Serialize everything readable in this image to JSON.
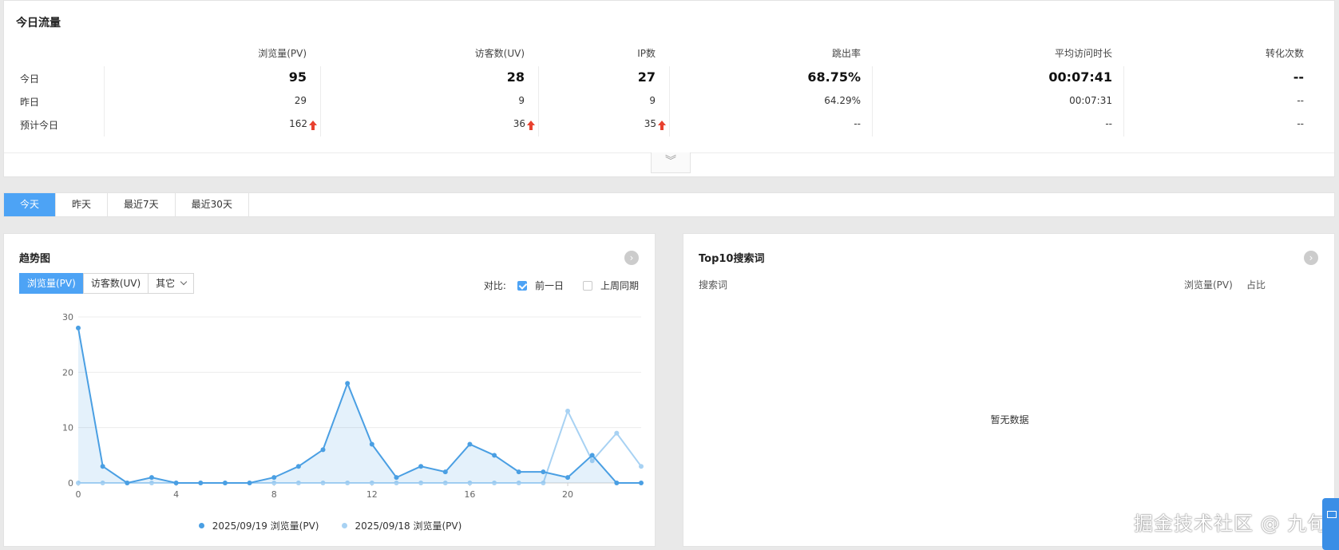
{
  "today_traffic": {
    "title": "今日流量",
    "columns": [
      "浏览量(PV)",
      "访客数(UV)",
      "IP数",
      "跳出率",
      "平均访问时长",
      "转化次数"
    ],
    "rows": [
      {
        "label": "今日",
        "values": [
          "95",
          "28",
          "27",
          "68.75%",
          "00:07:41",
          "--"
        ],
        "up": [
          false,
          false,
          false,
          false,
          false,
          false
        ]
      },
      {
        "label": "昨日",
        "values": [
          "29",
          "9",
          "9",
          "64.29%",
          "00:07:31",
          "--"
        ],
        "up": [
          false,
          false,
          false,
          false,
          false,
          false
        ]
      },
      {
        "label": "预计今日",
        "values": [
          "162",
          "36",
          "35",
          "--",
          "--",
          "--"
        ],
        "up": [
          true,
          true,
          true,
          false,
          false,
          false
        ]
      }
    ],
    "expand_icon": "double-chevron-down-icon"
  },
  "time_tabs": {
    "items": [
      "今天",
      "昨天",
      "最近7天",
      "最近30天"
    ],
    "active_index": 0
  },
  "trend": {
    "title": "趋势图",
    "metric_tabs": [
      "浏览量(PV)",
      "访客数(UV)",
      "其它"
    ],
    "active_metric": 0,
    "compare_label": "对比:",
    "compare_options": [
      {
        "label": "前一日",
        "checked": true
      },
      {
        "label": "上周同期",
        "checked": false
      }
    ],
    "more_icon": "chevron-right-circle-icon"
  },
  "chart_data": {
    "type": "line",
    "x": [
      0,
      1,
      2,
      3,
      4,
      5,
      6,
      7,
      8,
      9,
      10,
      11,
      12,
      13,
      14,
      15,
      16,
      17,
      18,
      19,
      20,
      21,
      22,
      23
    ],
    "x_ticks": [
      0,
      4,
      8,
      12,
      16,
      20
    ],
    "y_ticks": [
      0,
      10,
      20,
      30
    ],
    "ylim": [
      0,
      30
    ],
    "xlim": [
      0,
      23
    ],
    "grid": true,
    "legend_position": "bottom-center",
    "series": [
      {
        "name": "2025/09/19 浏览量(PV)",
        "color": "#4a9fe3",
        "area": true,
        "values": [
          28,
          3,
          0,
          1,
          0,
          0,
          0,
          0,
          1,
          3,
          6,
          18,
          7,
          1,
          3,
          2,
          7,
          5,
          2,
          2,
          1,
          5,
          0,
          0
        ]
      },
      {
        "name": "2025/09/18 浏览量(PV)",
        "color": "#a8d2f3",
        "area": false,
        "values": [
          0,
          0,
          0,
          0,
          0,
          0,
          0,
          0,
          0,
          0,
          0,
          0,
          0,
          0,
          0,
          0,
          0,
          0,
          0,
          0,
          13,
          4,
          9,
          3
        ]
      }
    ]
  },
  "top10": {
    "title": "Top10搜索词",
    "col_keyword": "搜索词",
    "col_pv": "浏览量(PV)",
    "col_ratio": "占比",
    "empty_text": "暂无数据"
  },
  "watermark": "掘金技术社区 @ 九旬"
}
